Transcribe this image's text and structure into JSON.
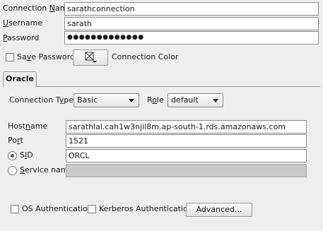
{
  "connection": {
    "name_label_pre": "Connection ",
    "name_label_ul": "N",
    "name_label_post": "ame",
    "name_value": "sarathconnection",
    "username_label_ul": "U",
    "username_label_post": "sername",
    "username_value": "sarath",
    "password_label_ul": "P",
    "password_label_post": "assword",
    "password_mask": "●●●●●●●●●●●●●"
  },
  "save_password": {
    "label_pre": "Sa",
    "label_ul": "v",
    "label_post": "e Password",
    "checked": false
  },
  "connection_color": {
    "label": "Connection Color",
    "icon": "color-picker-icon"
  },
  "tab": {
    "label": "Oracle"
  },
  "oracle": {
    "conn_type_label_pre": "Connection T",
    "conn_type_label_ul": "y",
    "conn_type_label_post": "pe",
    "conn_type_value": "Basic",
    "role_label_pre": "R",
    "role_label_ul": "o",
    "role_label_post": "le",
    "role_value": "default",
    "hostname_label_pre": "Host",
    "hostname_label_ul": "n",
    "hostname_label_post": "ame",
    "hostname_value": "sarathlal.cah1w3njil8m.ap-south-1.rds.amazonaws.com",
    "port_label_pre": "Po",
    "port_label_ul": "r",
    "port_label_post": "t",
    "port_value": "1521",
    "sid_label_pre": "S",
    "sid_label_ul": "I",
    "sid_label_post": "D",
    "sid_value": "ORCL",
    "sid_selected": true,
    "service_label_pre": "",
    "service_label_ul": "S",
    "service_label_post": "ervice name",
    "service_value": ""
  },
  "footer": {
    "os_auth_label": "OS Authentication",
    "kerberos_label": "Kerberos Authentication",
    "advanced_label": "Advanced..."
  },
  "colors": {
    "background": "#eeeeee",
    "radio_dot": "#2d5d9f",
    "disabled_field": "#c8c8c8"
  }
}
